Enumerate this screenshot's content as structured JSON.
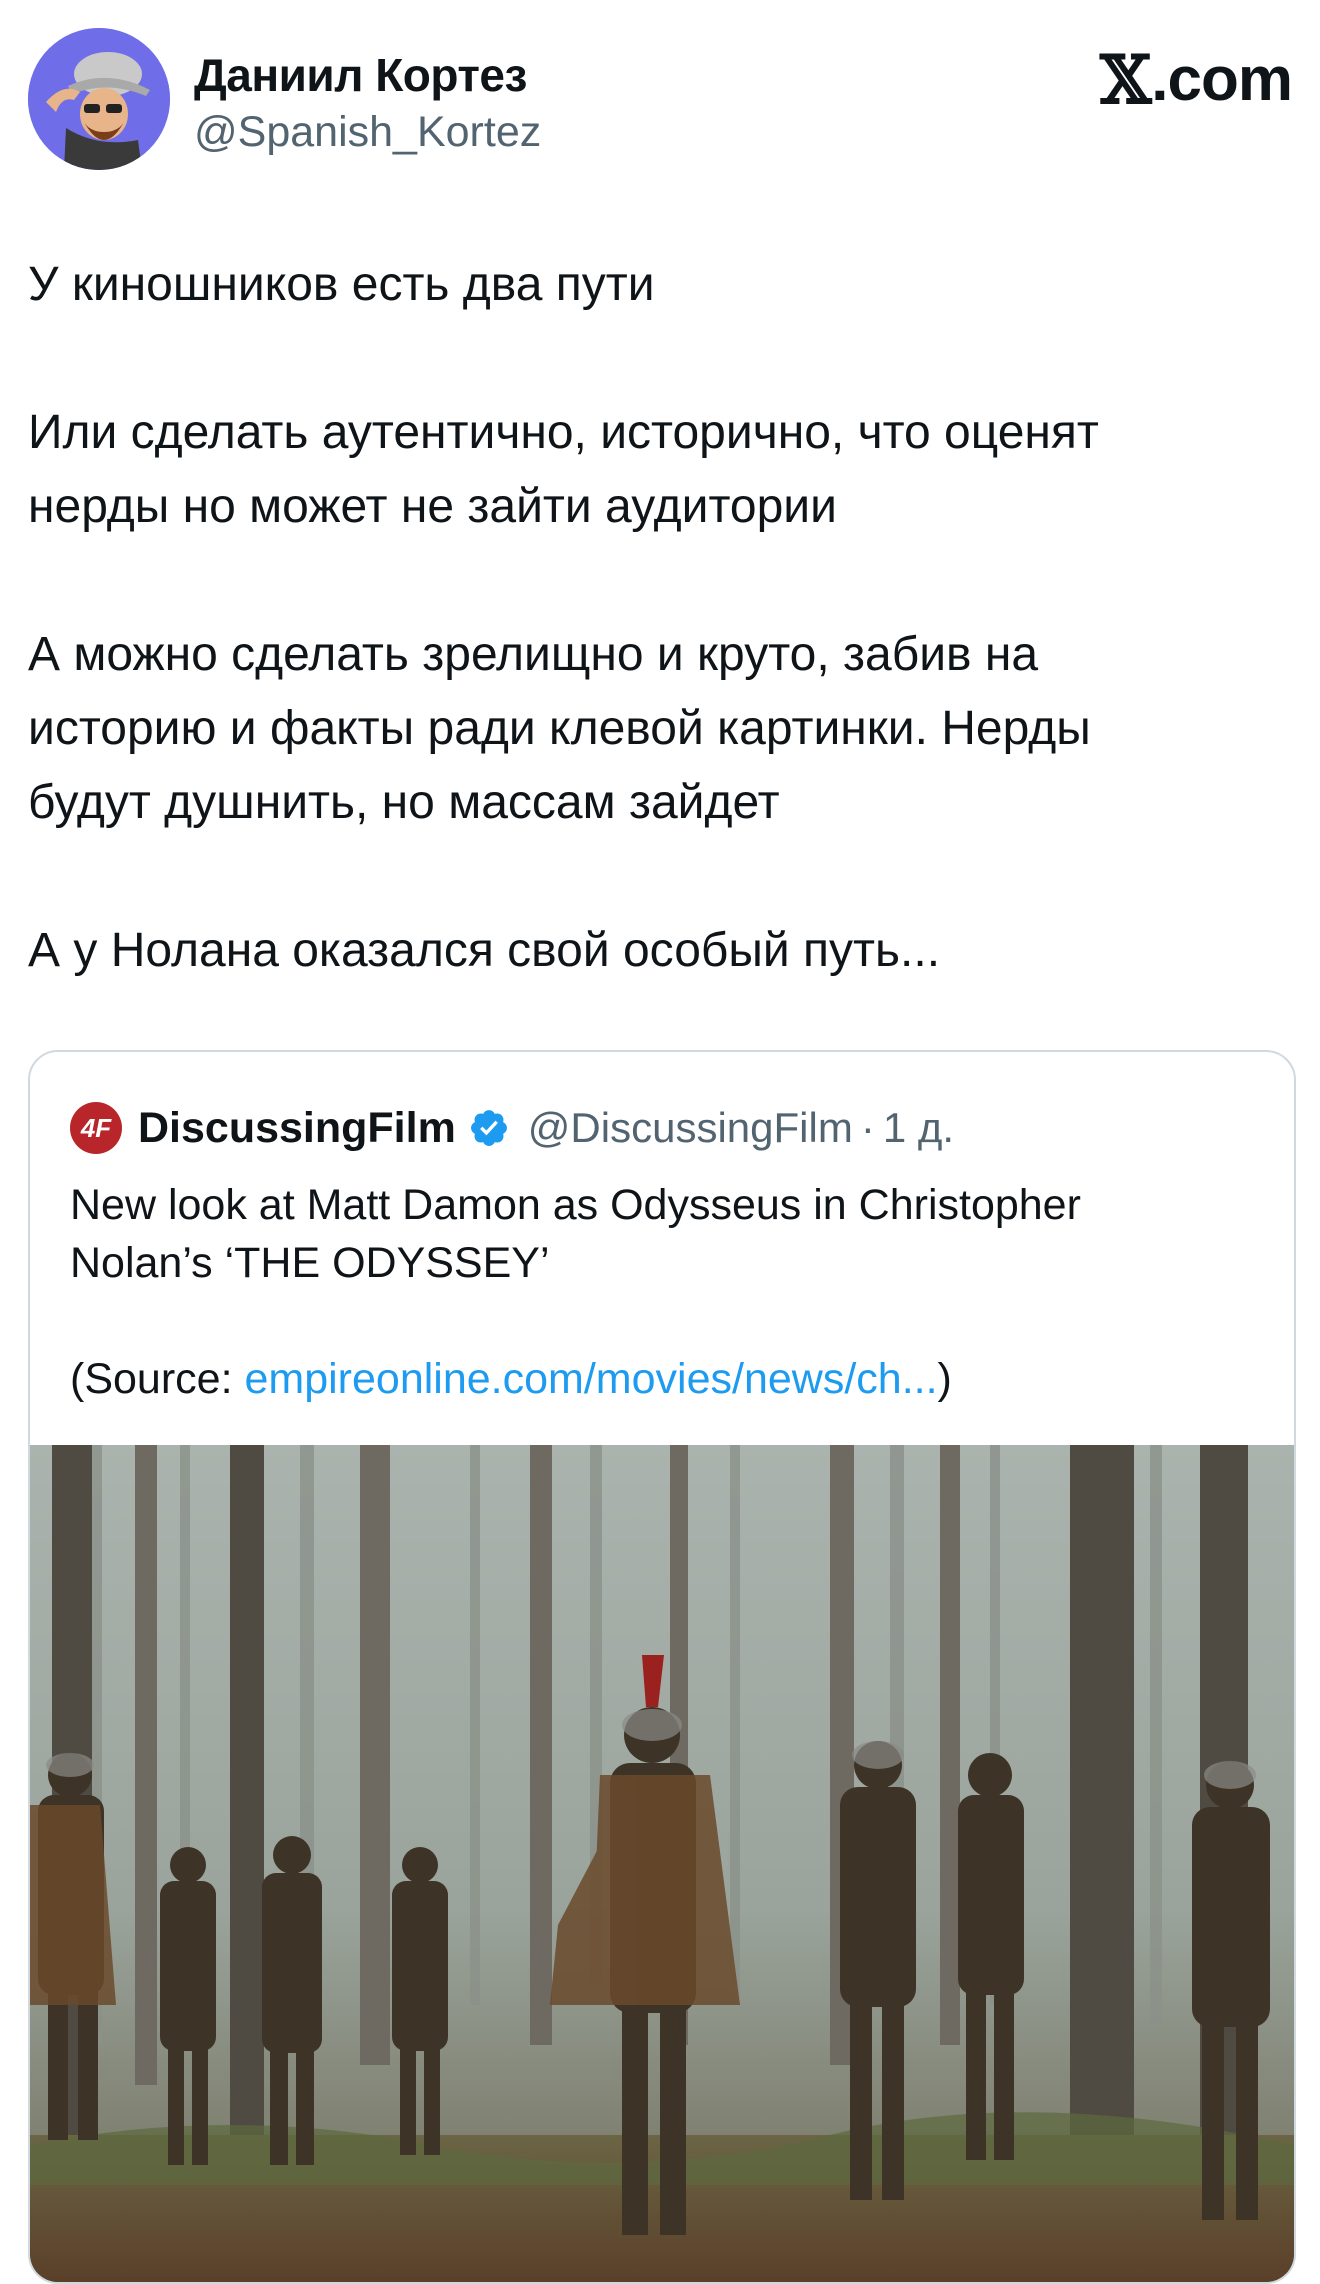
{
  "author": {
    "name": "Даниил Кортез",
    "handle": "@Spanish_Kortez"
  },
  "brand": {
    "x": "𝕏",
    "domain": ".com"
  },
  "tweet": {
    "line1": "У киношников есть два пути",
    "para2_line1": "Или сделать аутентично, исторично, что оценят",
    "para2_line2": "нерды но может не зайти аудитории",
    "para3_line1": "А можно сделать зрелищно и круто, забив на",
    "para3_line2": "историю и факты ради клевой картинки. Нерды",
    "para3_line3": "будут душнить, но массам зайдет",
    "para4": "А у Нолана оказался свой особый путь..."
  },
  "quoted": {
    "logo_text": "4F",
    "name": "DiscussingFilm",
    "handle": "@DiscussingFilm",
    "dot": "·",
    "time": "1 д.",
    "text_line1": "New look at Matt Damon as Odysseus in Christopher",
    "text_line2": "Nolan’s ‘THE ODYSSEY’",
    "source_prefix": "(Source: ",
    "source_link": "empireonline.com/movies/news/ch...",
    "source_suffix": ")"
  },
  "colors": {
    "link": "#1d9bf0",
    "verified": "#1d9bf0",
    "avatar_bg": "#6f6ee8",
    "logo_bg": "#b8252a"
  },
  "icons": {
    "verified": "verified-badge-icon",
    "brand": "x-logo-icon"
  }
}
